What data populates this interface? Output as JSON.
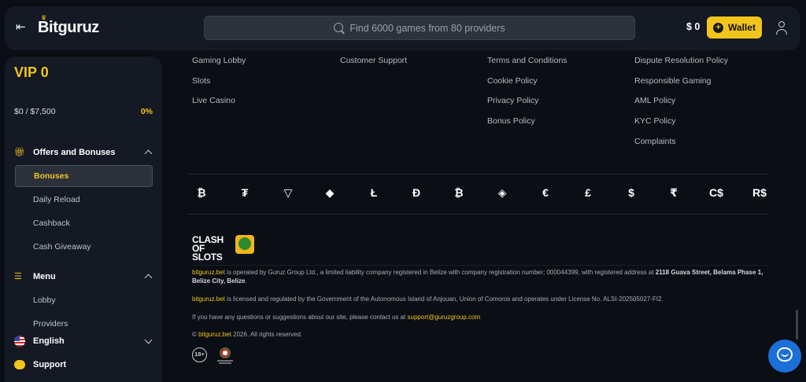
{
  "header": {
    "logo": "Bitguruz",
    "search_placeholder": "Find 6000 games from 80 providers",
    "balance": "$ 0",
    "wallet_label": "Wallet"
  },
  "sidebar": {
    "vip_title": "VIP 0",
    "vip_progress_text": "$0 / $7,500",
    "vip_progress": 0,
    "vip_percent": "0%",
    "offers_label": "Offers and Bonuses",
    "offers_items": [
      "Bonuses",
      "Daily Reload",
      "Cashback",
      "Cash Giveaway"
    ],
    "menu_label": "Menu",
    "menu_items": [
      "Lobby",
      "Providers"
    ],
    "language": "English",
    "support": "Support"
  },
  "footer": {
    "col1": [
      "Gaming Lobby",
      "Slots",
      "Live Casino"
    ],
    "col2": [
      "Customer Support"
    ],
    "col3": [
      "Terms and Conditions",
      "Cookie Policy",
      "Privacy Policy",
      "Bonus Policy"
    ],
    "col4": [
      "Dispute Resolution Policy",
      "Responsible Gaming",
      "AML Policy",
      "KYC Policy",
      "Complaints"
    ],
    "currencies": [
      "₿",
      "₮",
      "▽",
      "◆",
      "Ł",
      "Đ",
      "₿",
      "◈",
      "€",
      "£",
      "$",
      "₹",
      "C$",
      "R$"
    ],
    "partner_logo": "CLASH OF SLOTS",
    "legal1_site": "bitguruz.bet",
    "legal1_text": " is operated by Guruz Group Ltd., a limited liability company registered in Belize with company registration number: 000044399, with registered address at ",
    "legal1_address": "2118 Guava Street, Belama Phase 1, Belize City, Belize",
    "legal1_end": ".",
    "legal2_site": "bitguruz.bet",
    "legal2_text": " is licensed and regulated by the Government of the Autonomous Island of Anjouan, Union of Comoros and operates under License No. ALSI-202505027-FI2.",
    "legal3_text": "If you have any questions or suggestions about our site, please contact us at ",
    "legal3_email": "support@guruzgroup.com",
    "copyright_prefix": "© ",
    "copyright_site": "bitguruz.bet",
    "copyright_text": " 2026. All rights reserved.",
    "age_badge": "18+"
  }
}
